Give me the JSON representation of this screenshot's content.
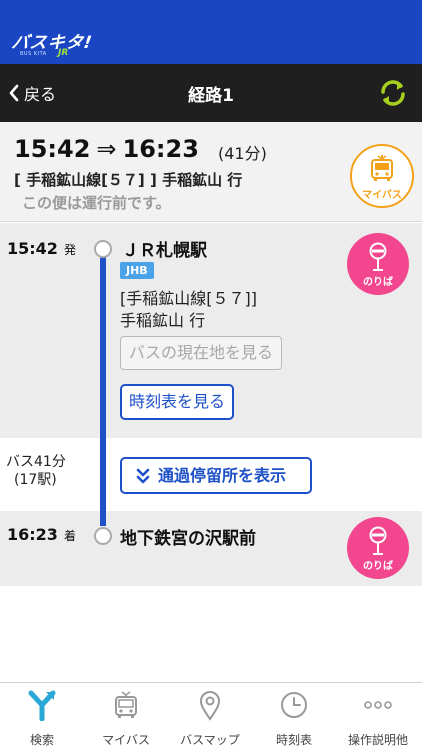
{
  "brand": {
    "logo_text": "バスキタ!",
    "logo_sub": "JR",
    "logo_tiny": "BUS KITA"
  },
  "nav": {
    "back_label": "戻る",
    "title": "経路1"
  },
  "summary": {
    "departure_time": "15:42",
    "arrival_time": "16:23",
    "arrow": "⇒",
    "duration": "(41分)",
    "line_text": "[ 手稲鉱山線[５７] ] 手稲鉱山 行",
    "notice": "この便は運行前です。",
    "mybus_label": "マイバス"
  },
  "route": {
    "departure": {
      "time": "15:42",
      "suffix": "発",
      "stop_name": "ＪＲ札幌駅",
      "operator_badge": "JHB",
      "line_name": "[手稲鉱山線[５７]]",
      "destination": "手稲鉱山 行",
      "location_button": "バスの現在地を見る",
      "timetable_button": "時刻表を見る",
      "platform_label": "のりば"
    },
    "ride": {
      "duration": "バス41分",
      "stops": "(17駅)",
      "passing_button": "通過停留所を表示"
    },
    "arrival": {
      "time": "16:23",
      "suffix": "着",
      "stop_name": "地下鉄宮の沢駅前",
      "platform_label": "のりば"
    }
  },
  "tabs": [
    {
      "label": "検索",
      "icon": "search-route-icon"
    },
    {
      "label": "マイバス",
      "icon": "mybus-icon"
    },
    {
      "label": "バスマップ",
      "icon": "map-pin-icon"
    },
    {
      "label": "時刻表",
      "icon": "clock-icon"
    },
    {
      "label": "操作説明他",
      "icon": "more-icon"
    }
  ],
  "colors": {
    "brand_blue": "#1a46c4",
    "nav_dark": "#1f1f1f",
    "route_blue": "#1e50c8",
    "platform_pink": "#f2478e",
    "mybus_orange": "#f4a11a",
    "refresh_green": "#a6cf1e",
    "tab_active": "#2aa9d6"
  }
}
